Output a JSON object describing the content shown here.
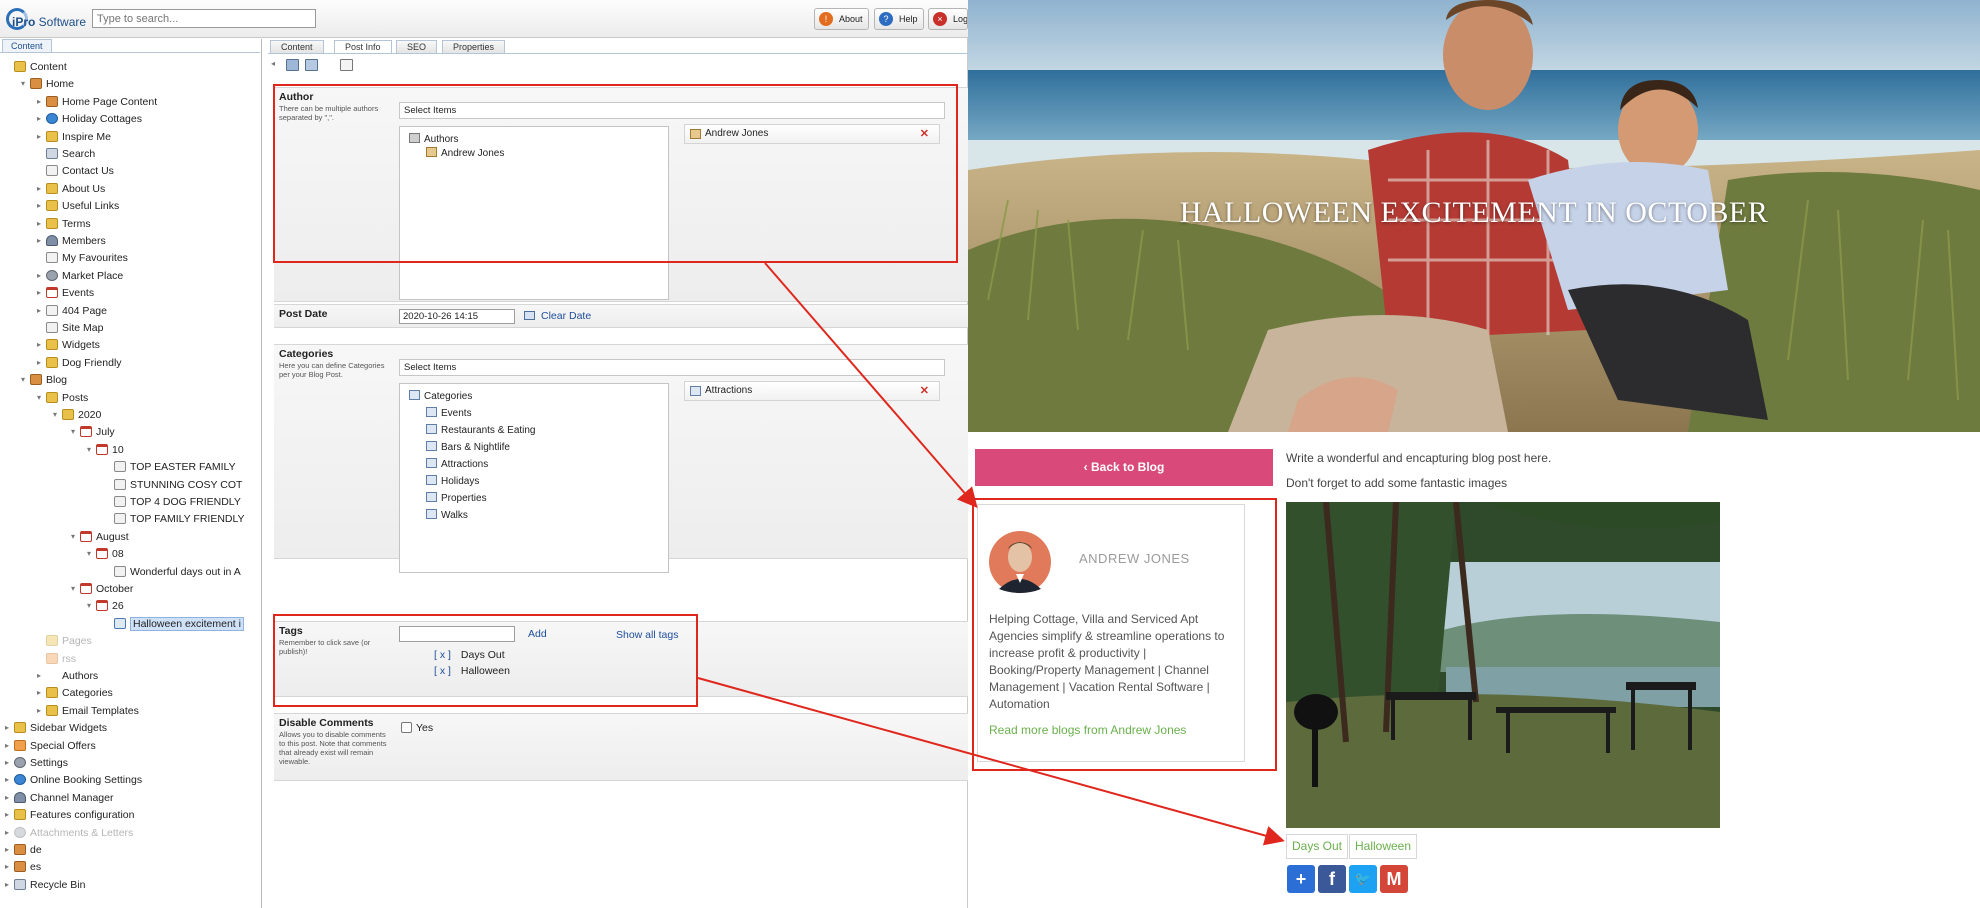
{
  "cms": {
    "logo_text_bold": "iPro",
    "logo_text": " Software",
    "search_placeholder": "Type to search...",
    "buttons": {
      "about": "About",
      "help": "Help",
      "logout": "Logo"
    },
    "tree_tab": "Content",
    "tree": [
      "Content",
      "Home",
      "Home Page Content",
      "Holiday Cottages",
      "Inspire Me",
      "Search",
      "Contact Us",
      "About Us",
      "Useful Links",
      "Terms",
      "Members",
      "My Favourites",
      "Market Place",
      "Events",
      "404 Page",
      "Site Map",
      "Widgets",
      "Dog Friendly",
      "Blog",
      "Posts",
      "2020",
      "July",
      "10",
      "TOP EASTER FAMILY",
      "STUNNING COSY COT",
      "TOP 4 DOG FRIENDLY",
      "TOP FAMILY FRIENDLY",
      "August",
      "08",
      "Wonderful days out in A",
      "October",
      "26",
      "Halloween excitement i",
      "Pages",
      "rss",
      "Authors",
      "Categories",
      "Email Templates",
      "Sidebar Widgets",
      "Special Offers",
      "Settings",
      "Online Booking Settings",
      "Channel Manager",
      "Features configuration",
      "Attachments & Letters",
      "de",
      "es",
      "Recycle Bin"
    ],
    "tabs": [
      "Content",
      "Post Info",
      "SEO",
      "Properties"
    ],
    "author": {
      "title": "Author",
      "help": "There can be multiple authors separated by \",\".",
      "select_label": "Select Items",
      "tree_root": "Authors",
      "tree_items": [
        "Andrew Jones"
      ],
      "selected": [
        "Andrew Jones"
      ]
    },
    "post_date": {
      "title": "Post Date",
      "value": "2020-10-26 14:15",
      "clear": "Clear Date"
    },
    "categories": {
      "title": "Categories",
      "help": "Here you can define Categories per your Blog Post.",
      "select_label": "Select Items",
      "tree_root": "Categories",
      "tree_items": [
        "Events",
        "Restaurants & Eating",
        "Bars & Nightlife",
        "Attractions",
        "Holidays",
        "Properties",
        "Walks"
      ],
      "selected": [
        "Attractions"
      ]
    },
    "tags": {
      "title": "Tags",
      "help": "Remember to click save (or publish)!",
      "add": "Add",
      "show_all": "Show all tags",
      "remove_label": "[ x ]",
      "items": [
        "Days Out",
        "Halloween"
      ]
    },
    "disable_comments": {
      "title": "Disable Comments",
      "help": "Allows you to disable comments to this post. Note that comments that already exist will remain viewable.",
      "option": "Yes",
      "checked": false
    }
  },
  "site": {
    "hero_title": "HALLOWEEN EXCITEMENT IN OCTOBER",
    "back_button": "‹ Back to Blog",
    "intro": [
      "Write a wonderful and encapturing blog post here.",
      "Don't forget to add some fantastic images"
    ],
    "author_name": "ANDREW JONES",
    "author_bio": "Helping Cottage, Villa and Serviced Apt Agencies simplify & streamline operations to increase profit & productivity | Booking/Property Management | Channel Management | Vacation Rental Software | Automation",
    "author_link": "Read more blogs from Andrew Jones",
    "tags": [
      "Days Out",
      "Halloween"
    ],
    "share_icons": [
      "addthis-plus-icon",
      "facebook-icon",
      "twitter-icon",
      "gmail-icon"
    ],
    "colors": {
      "accent_pink": "#d94a7b",
      "link_green": "#6ab04c",
      "highlight_red": "#e0271d"
    }
  }
}
